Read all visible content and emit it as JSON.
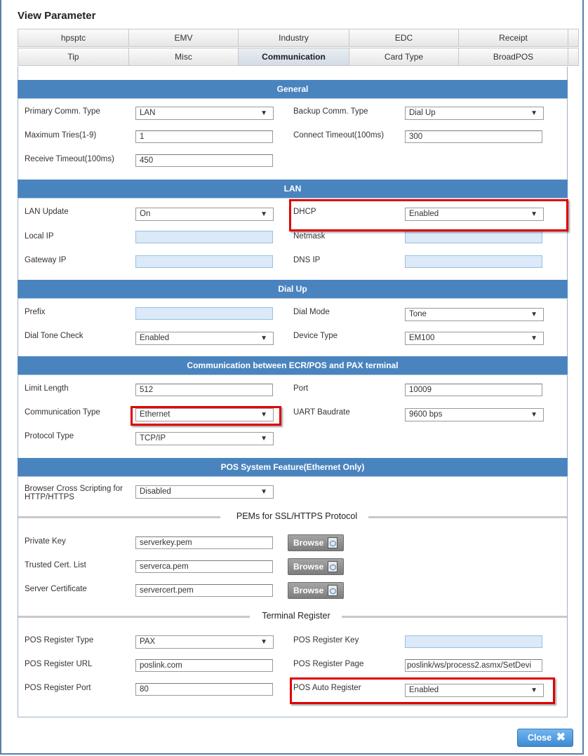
{
  "dialog": {
    "title": "View Parameter",
    "close_label": "Close"
  },
  "tabs": {
    "row1": [
      "hpsptc",
      "EMV",
      "Industry",
      "EDC",
      "Receipt"
    ],
    "row2": [
      "Tip",
      "Misc",
      "Communication",
      "Card Type",
      "BroadPOS"
    ],
    "active": "Communication"
  },
  "general": {
    "header": "General",
    "primary_comm_type_label": "Primary Comm. Type",
    "primary_comm_type_value": "LAN",
    "backup_comm_type_label": "Backup Comm. Type",
    "backup_comm_type_value": "Dial Up",
    "maximum_tries_label": "Maximum Tries(1-9)",
    "maximum_tries_value": "1",
    "connect_timeout_label": "Connect Timeout(100ms)",
    "connect_timeout_value": "300",
    "receive_timeout_label": "Receive Timeout(100ms)",
    "receive_timeout_value": "450"
  },
  "lan": {
    "header": "LAN",
    "lan_update_label": "LAN Update",
    "lan_update_value": "On",
    "dhcp_label": "DHCP",
    "dhcp_value": "Enabled",
    "local_ip_label": "Local IP",
    "local_ip_value": "",
    "netmask_label": "Netmask",
    "netmask_value": "",
    "gateway_ip_label": "Gateway IP",
    "gateway_ip_value": "",
    "dns_ip_label": "DNS IP",
    "dns_ip_value": ""
  },
  "dialup": {
    "header": "Dial Up",
    "prefix_label": "Prefix",
    "prefix_value": "",
    "dial_mode_label": "Dial Mode",
    "dial_mode_value": "Tone",
    "dial_tone_check_label": "Dial Tone Check",
    "dial_tone_check_value": "Enabled",
    "device_type_label": "Device Type",
    "device_type_value": "EM100"
  },
  "ecr": {
    "header": "Communication between ECR/POS and PAX terminal",
    "limit_length_label": "Limit Length",
    "limit_length_value": "512",
    "port_label": "Port",
    "port_value": "10009",
    "communication_type_label": "Communication Type",
    "communication_type_value": "Ethernet",
    "uart_baudrate_label": "UART Baudrate",
    "uart_baudrate_value": "9600 bps",
    "protocol_type_label": "Protocol Type",
    "protocol_type_value": "TCP/IP"
  },
  "pos_feature": {
    "header": "POS System Feature(Ethernet Only)",
    "browser_cross_label_line1": "Browser Cross Scripting for",
    "browser_cross_label_line2": "HTTP/HTTPS",
    "browser_cross_value": "Disabled",
    "pems_title": "PEMs for SSL/HTTPS Protocol",
    "private_key_label": "Private Key",
    "private_key_value": "serverkey.pem",
    "trusted_cert_label": "Trusted Cert. List",
    "trusted_cert_value": "serverca.pem",
    "server_cert_label": "Server Certificate",
    "server_cert_value": "servercert.pem",
    "browse_label": "Browse",
    "terminal_register_title": "Terminal Register",
    "pos_register_type_label": "POS Register Type",
    "pos_register_type_value": "PAX",
    "pos_register_key_label": "POS Register Key",
    "pos_register_key_value": "",
    "pos_register_url_label": "POS Register URL",
    "pos_register_url_value": "poslink.com",
    "pos_register_page_label": "POS Register Page",
    "pos_register_page_value": "poslink/ws/process2.asmx/SetDevi",
    "pos_register_port_label": "POS Register Port",
    "pos_register_port_value": "80",
    "pos_auto_register_label": "POS Auto Register",
    "pos_auto_register_value": "Enabled"
  },
  "icons": {
    "dropdown_arrow": "▼",
    "close_x": "✖"
  },
  "colors": {
    "section_header": "#4a84bf",
    "highlight": "#e00000",
    "close_button": "#4a96dc",
    "blank_input": "#dbe9f8"
  }
}
